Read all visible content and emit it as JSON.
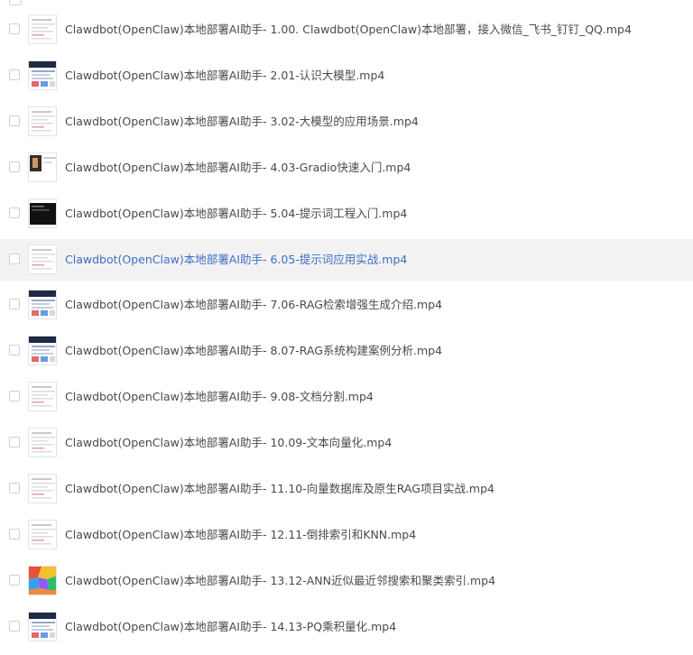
{
  "files": [
    {
      "name": "Clawdbot(OpenClaw)本地部署AI助手- 1.00. Clawdbot(OpenClaw)本地部署，接入微信_飞书_钉钉_QQ.mp4",
      "thumb_icon": "document-thumbnail",
      "highlighted": false
    },
    {
      "name": "Clawdbot(OpenClaw)本地部署AI助手- 2.01-认识大模型.mp4",
      "thumb_icon": "slide-thumbnail",
      "highlighted": false
    },
    {
      "name": "Clawdbot(OpenClaw)本地部署AI助手- 3.02-大模型的应用场景.mp4",
      "thumb_icon": "document-thumbnail",
      "highlighted": false
    },
    {
      "name": "Clawdbot(OpenClaw)本地部署AI助手- 4.03-Gradio快速入门.mp4",
      "thumb_icon": "photo-thumbnail",
      "highlighted": false
    },
    {
      "name": "Clawdbot(OpenClaw)本地部署AI助手- 5.04-提示词工程入门.mp4",
      "thumb_icon": "terminal-thumbnail",
      "highlighted": false
    },
    {
      "name": "Clawdbot(OpenClaw)本地部署AI助手- 6.05-提示词应用实战.mp4",
      "thumb_icon": "document-thumbnail",
      "highlighted": true
    },
    {
      "name": "Clawdbot(OpenClaw)本地部署AI助手- 7.06-RAG检索增强生成介绍.mp4",
      "thumb_icon": "slide-thumbnail",
      "highlighted": false
    },
    {
      "name": "Clawdbot(OpenClaw)本地部署AI助手- 8.07-RAG系统构建案例分析.mp4",
      "thumb_icon": "slide-thumbnail",
      "highlighted": false
    },
    {
      "name": "Clawdbot(OpenClaw)本地部署AI助手- 9.08-文档分割.mp4",
      "thumb_icon": "document-thumbnail",
      "highlighted": false
    },
    {
      "name": "Clawdbot(OpenClaw)本地部署AI助手- 10.09-文本向量化.mp4",
      "thumb_icon": "document-thumbnail",
      "highlighted": false
    },
    {
      "name": "Clawdbot(OpenClaw)本地部署AI助手- 11.10-向量数据库及原生RAG项目实战.mp4",
      "thumb_icon": "document-thumbnail",
      "highlighted": false
    },
    {
      "name": "Clawdbot(OpenClaw)本地部署AI助手- 12.11-倒排索引和KNN.mp4",
      "thumb_icon": "document-thumbnail",
      "highlighted": false
    },
    {
      "name": "Clawdbot(OpenClaw)本地部署AI助手- 13.12-ANN近似最近邻搜索和聚类索引.mp4",
      "thumb_icon": "color-map-thumbnail",
      "highlighted": false
    },
    {
      "name": "Clawdbot(OpenClaw)本地部署AI助手- 14.13-PQ乘积量化.mp4",
      "thumb_icon": "slide-thumbnail",
      "highlighted": false
    }
  ],
  "colors": {
    "highlight_bg": "#f2f2f2",
    "highlight_text": "#3d6fc4",
    "text": "#4a4a4a"
  }
}
